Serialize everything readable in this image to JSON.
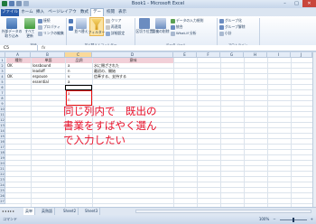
{
  "window": {
    "title": "Book1 - Microsoft Excel"
  },
  "tabs": [
    "ファイル",
    "ホーム",
    "挿入",
    "ページレイアウト",
    "数式",
    "データ",
    "校閲",
    "表示"
  ],
  "ribbon": {
    "ext_data": "外部データの\n取り込み",
    "refresh": "すべて\n更新",
    "connections": "接続",
    "properties": "プロパティ",
    "edit_links": "リンクの編集",
    "sort": "並べ替え",
    "filter": "フィルター",
    "clear": "クリア",
    "reapply": "再適用",
    "advanced": "詳細設定",
    "text_to_columns": "区切り位置",
    "remove_dup": "重複の削除",
    "validation": "データの入力規則",
    "consolidate": "統合",
    "whatif": "What-If 分析",
    "group": "グループ化",
    "ungroup": "グループ解除",
    "subtotal": "小計",
    "group_connections": "接続",
    "group_sort": "並べ替えとフィルター",
    "group_tools": "データ ツール",
    "group_outline": "アウトライン"
  },
  "formula_bar": {
    "name_box": "C5",
    "fx": "fx",
    "value": ""
  },
  "columns": [
    "A",
    "B",
    "C",
    "D",
    "E",
    "F",
    "G",
    "H",
    "I",
    "J"
  ],
  "rows": [
    "1",
    "2",
    "3",
    "4",
    "5",
    "6",
    "7",
    "8",
    "9",
    "10",
    "11",
    "12",
    "13",
    "14",
    "15",
    "16",
    "17",
    "18",
    "19",
    "20",
    "21",
    "22",
    "23",
    "24",
    "25",
    "26",
    "27"
  ],
  "table": {
    "headers": [
      "種別",
      "単語",
      "品詞",
      "意味"
    ],
    "rows": [
      [
        "OK",
        "lossbound",
        "a",
        "水に閉ざされた"
      ],
      [
        "",
        "leadoff",
        "n",
        "最初の、開始"
      ],
      [
        "OK",
        "espouse",
        "v",
        "信奉する、支持する"
      ],
      [
        "",
        "essential",
        "a",
        ""
      ]
    ]
  },
  "red_marks": [
    "a",
    "n"
  ],
  "annotation": "同じ列内で　既出の\n書業をすばやく選ん\nで入力したい",
  "sheets": [
    "英単",
    "英熟語",
    "Sheet2",
    "Sheet3"
  ],
  "status": {
    "mode": "コマンド",
    "zoom": "100%"
  }
}
